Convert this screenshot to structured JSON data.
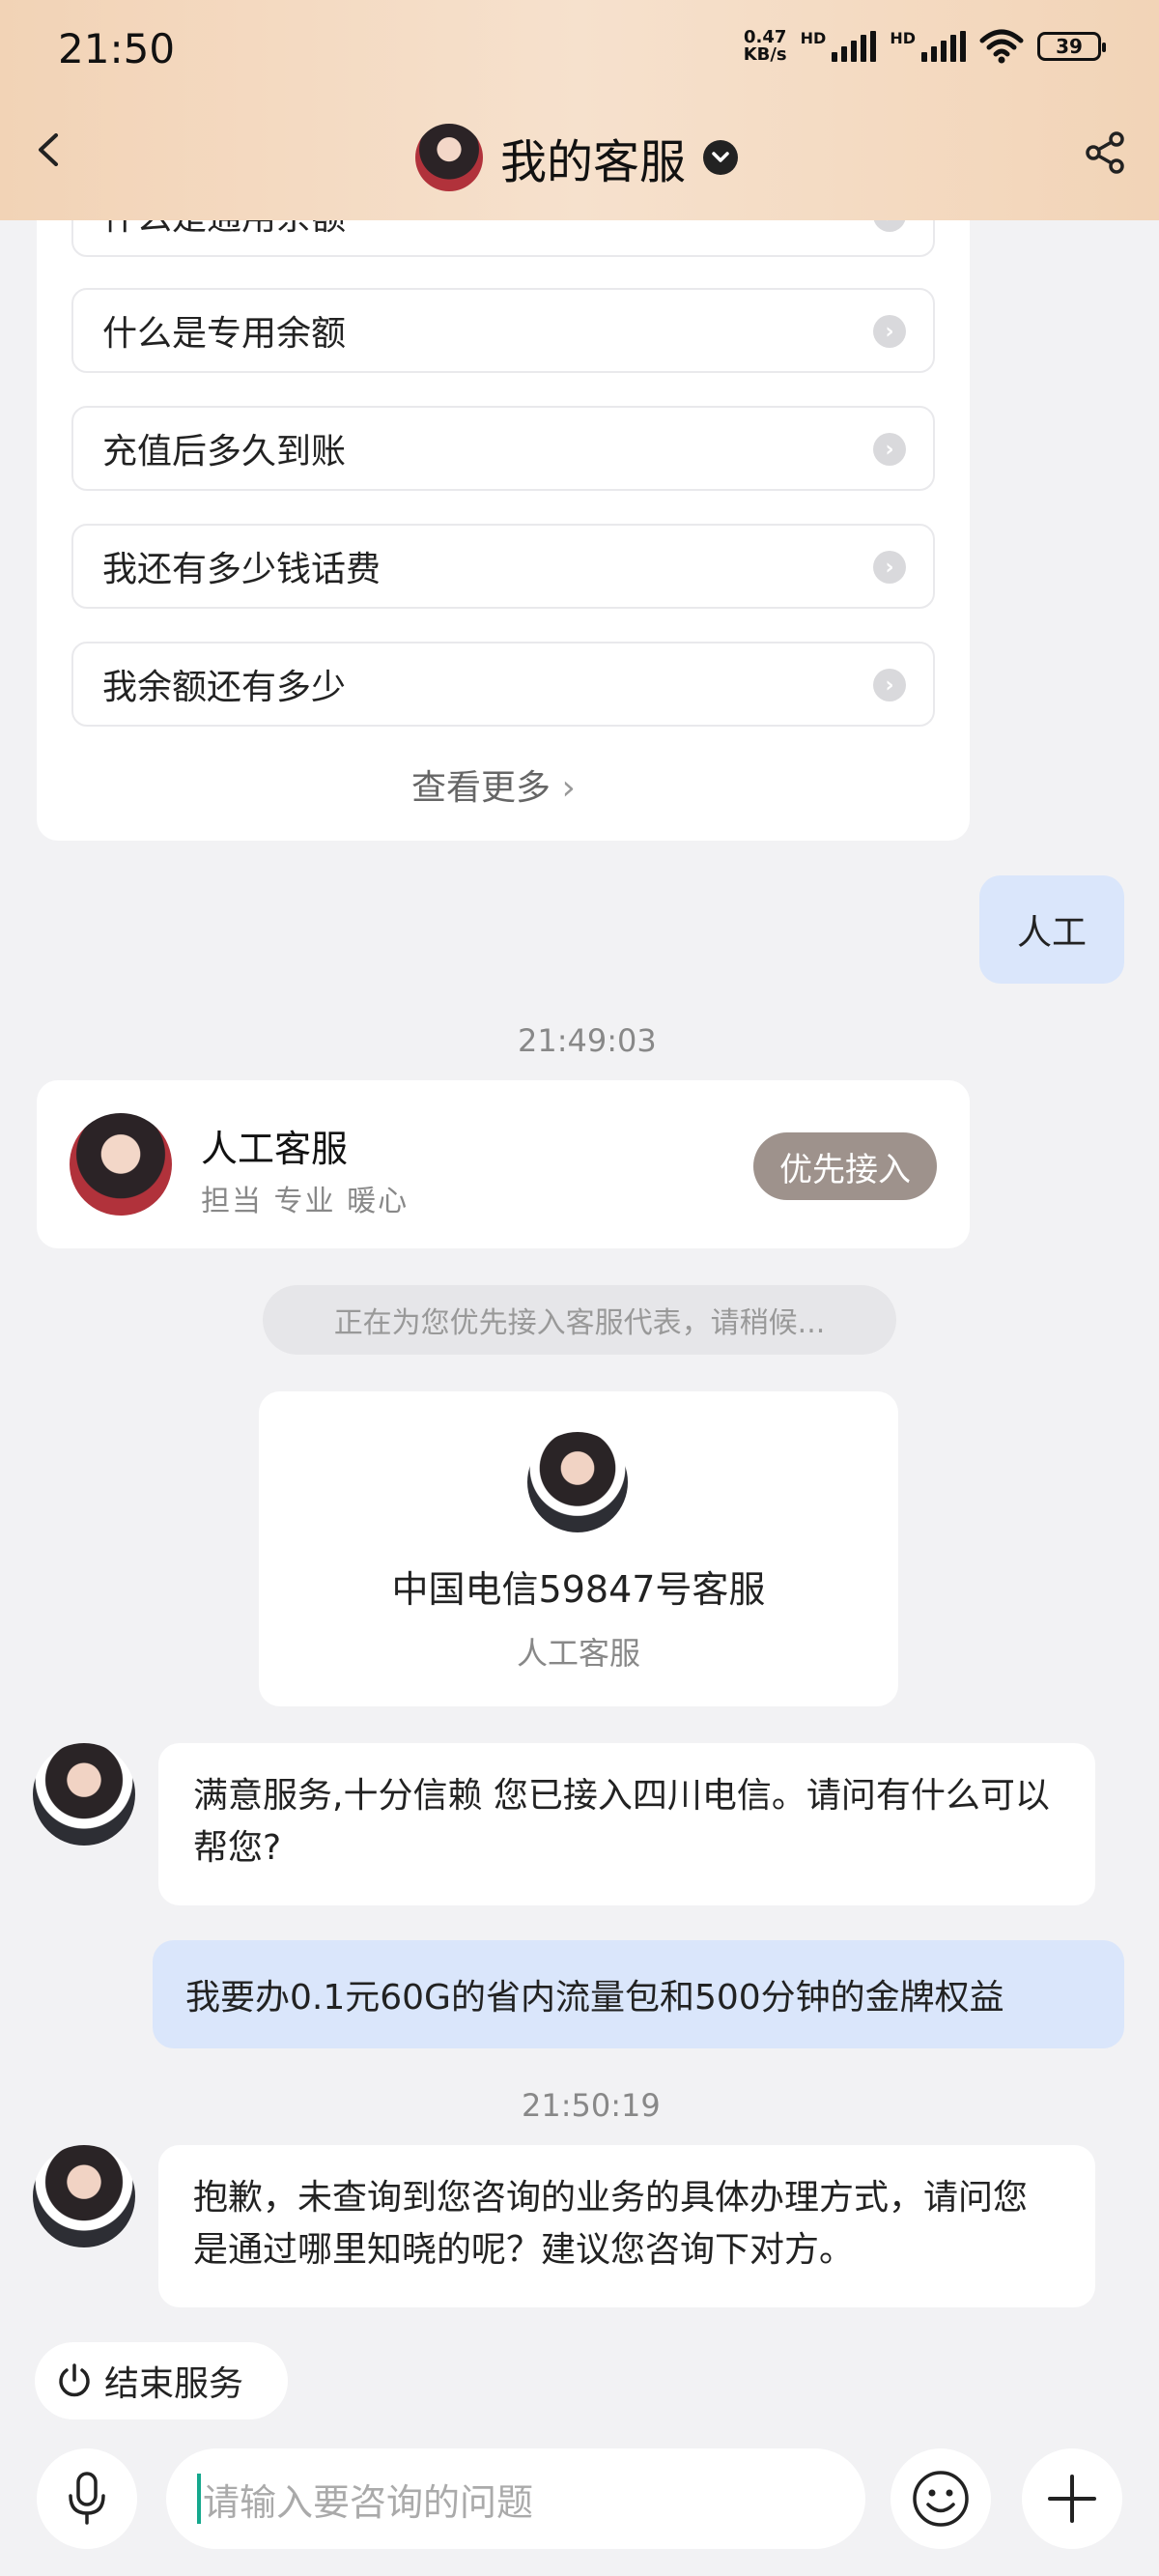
{
  "status_bar": {
    "time": "21:50",
    "net_speed_value": "0.47",
    "net_speed_unit": "KB/s",
    "battery": "39"
  },
  "header": {
    "title": "我的客服"
  },
  "faq": {
    "items": [
      "什么是通用余额",
      "什么是专用余额",
      "充值后多久到账",
      "我还有多少钱话费",
      "我余额还有多少"
    ],
    "more_label": "查看更多"
  },
  "messages": {
    "user_1": "人工",
    "time_1": "21:49:03",
    "agent_card": {
      "name": "人工客服",
      "tags": "担当 专业 暖心",
      "button": "优先接入"
    },
    "notice": "正在为您优先接入客服代表，请稍候...",
    "rep_card": {
      "name": "中国电信59847号客服",
      "role": "人工客服"
    },
    "agent_1": "满意服务,十分信赖 您已接入四川电信。请问有什么可以帮您?",
    "user_2": "我要办0.1元60G的省内流量包和500分钟的金牌权益",
    "time_2": "21:50:19",
    "agent_2": "抱歉，未查询到您咨询的业务的具体办理方式，请问您是通过哪里知晓的呢？建议您咨询下对方。"
  },
  "footer": {
    "end_service": "结束服务",
    "input_placeholder": "请输入要咨询的问题"
  }
}
